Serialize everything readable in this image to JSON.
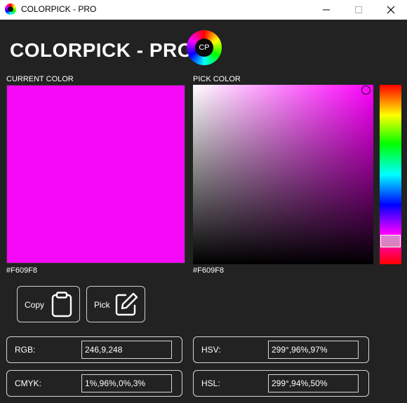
{
  "window": {
    "title": "COLORPICK - PRO"
  },
  "header": {
    "title": "COLORPICK - PRO",
    "logo_text": "CP"
  },
  "current": {
    "label": "CURRENT COLOR",
    "hex": "#F609F8"
  },
  "pick": {
    "label": "PICK COLOR",
    "hex": "#F609F8"
  },
  "actions": {
    "copy_label": "Copy",
    "pick_label": "Pick"
  },
  "values": {
    "rgb_label": "RGB:",
    "rgb": "246,9,248",
    "hsv_label": "HSV:",
    "hsv": "299°,96%,97%",
    "cmyk_label": "CMYK:",
    "cmyk": "1%,96%,0%,3%",
    "hsl_label": "HSL:",
    "hsl": "299°,94%,50%"
  },
  "colors": {
    "selected": "#F609F8",
    "background": "#222222"
  },
  "icons": [
    "close-icon",
    "minimize-icon",
    "maximize-icon",
    "clipboard-icon",
    "edit-icon"
  ]
}
